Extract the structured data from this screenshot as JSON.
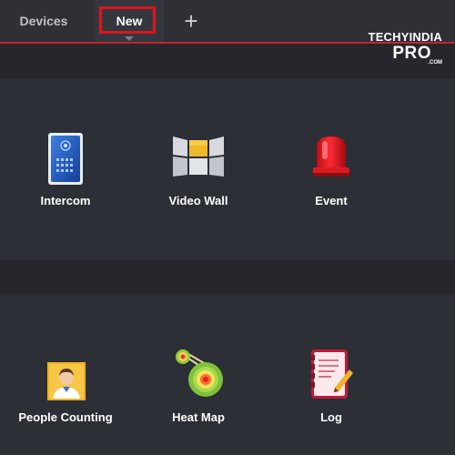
{
  "tabs": {
    "devices_label": "Devices",
    "new_label": "New",
    "add_label": "+"
  },
  "logo": {
    "line1": "TECHYINDIA",
    "line2": "PRO",
    "line3": ".COM"
  },
  "tiles_row1": [
    {
      "label": "Intercom",
      "icon": "intercom-icon"
    },
    {
      "label": "Video Wall",
      "icon": "video-wall-icon"
    },
    {
      "label": "Event",
      "icon": "alarm-light-icon"
    }
  ],
  "tiles_row2": [
    {
      "label": "People Counting",
      "icon": "people-counting-icon"
    },
    {
      "label": "Heat Map",
      "icon": "heat-map-icon"
    },
    {
      "label": "Log",
      "icon": "log-icon"
    }
  ],
  "colors": {
    "accent_red": "#c8232b",
    "highlight_box": "#e0141c",
    "background": "#2a2d33"
  }
}
